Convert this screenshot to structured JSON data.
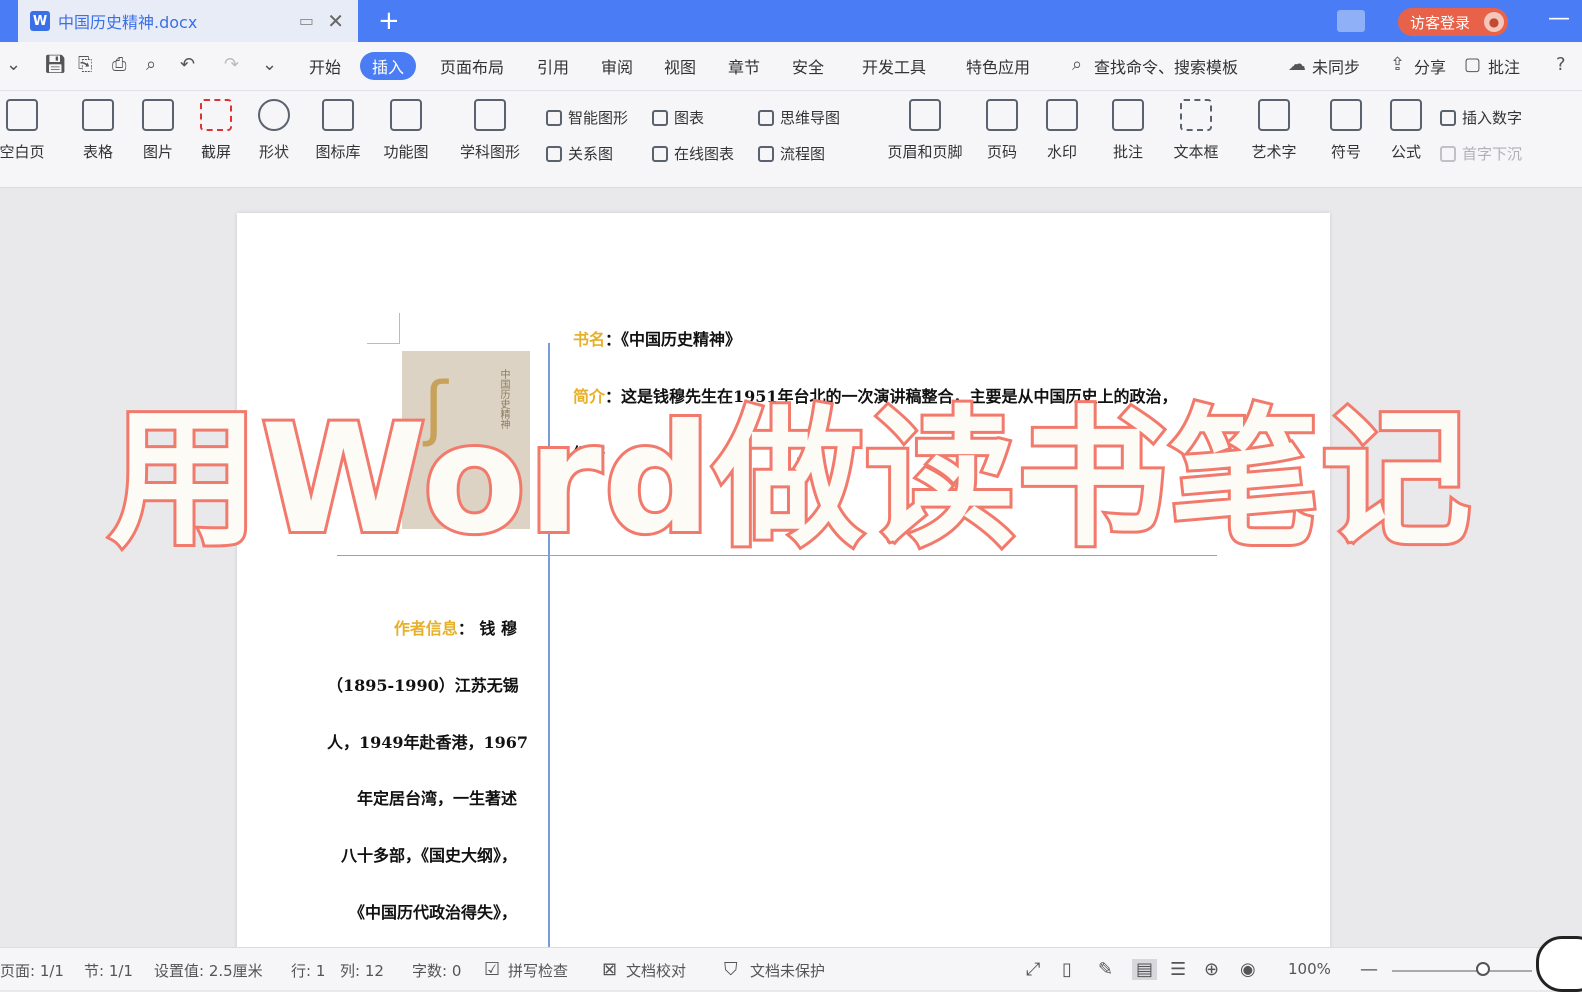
{
  "titlebar": {
    "doc_icon": "W",
    "doc_name": "中国历史精神.docx",
    "new_tab": "+",
    "login": "访客登录"
  },
  "menu": {
    "items": [
      "开始",
      "插入",
      "页面布局",
      "引用",
      "审阅",
      "视图",
      "章节",
      "安全",
      "开发工具",
      "特色应用"
    ],
    "active": "插入",
    "search": "查找命令、搜索模板",
    "sync": "未同步",
    "share": "分享",
    "comment": "批注"
  },
  "ribbon": {
    "blank_page": "空白页",
    "table": "表格",
    "picture": "图片",
    "screenshot": "截屏",
    "shape": "形状",
    "icon_lib": "图标库",
    "func_chart": "功能图",
    "subject_shape": "学科图形",
    "smart_art": "智能图形",
    "chart": "图表",
    "mind_map": "思维导图",
    "relation": "关系图",
    "online_chart": "在线图表",
    "flowchart": "流程图",
    "header_footer": "页眉和页脚",
    "page_num": "页码",
    "watermark": "水印",
    "annotation": "批注",
    "textbox": "文本框",
    "wordart": "艺术字",
    "symbol": "符号",
    "formula": "公式",
    "insert_number": "插入数字",
    "dropcap": "首字下沉"
  },
  "document": {
    "book_label": "书名",
    "book_value": "：《中国历史精神》",
    "intro_label": "简介",
    "intro_line1": "：这是钱穆先生在1951年台北的一次演讲稿整合，主要是从中国历史上的政治，",
    "intro_line2": "经济",
    "author_label": "作者信息",
    "author_lines": [
      "：  钱 穆",
      "（1895-1990）江苏无锡",
      "人，1949年赴香港，1967",
      "年定居台湾，一生著述",
      "八十多部，《国史大纲》，",
      "《中国历代政治得失》，"
    ]
  },
  "overlay": {
    "text": "用Word做读书笔记"
  },
  "status": {
    "page": "页面: 1/1",
    "section": "节: 1/1",
    "setting": "设置值: 2.5厘米",
    "row": "行: 1",
    "col": "列: 12",
    "words": "字数: 0",
    "spell": "拼写检查",
    "proof": "文档校对",
    "protect": "文档未保护",
    "zoom": "100%"
  }
}
